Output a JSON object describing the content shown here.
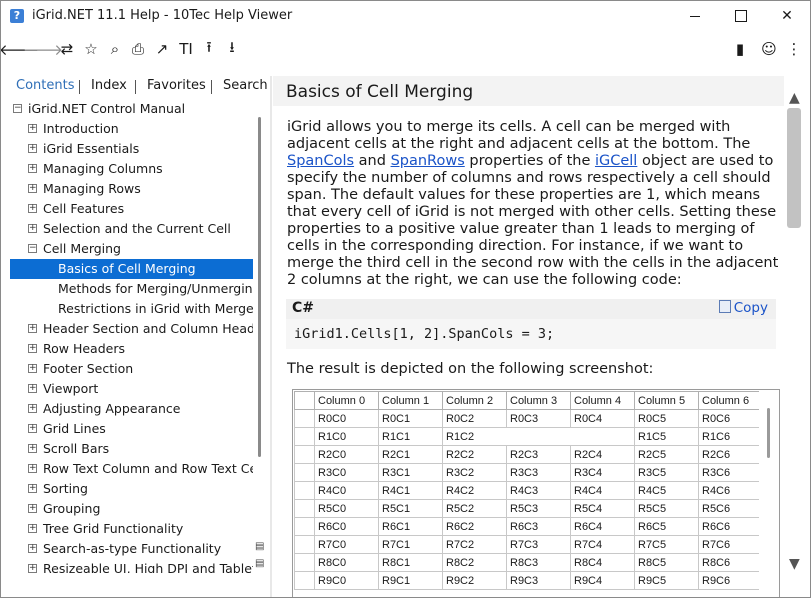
{
  "window": {
    "title": "iGrid.NET 11.1 Help - 10Tec Help Viewer",
    "app_icon": "?",
    "minimize_icon": "minimize-icon",
    "maximize_icon": "maximize-icon",
    "close_glyph": "✕"
  },
  "toolbar": {
    "back": "🡐",
    "forward": "🡒",
    "sync": "⇄",
    "favorite_add": "☆",
    "search": "⌕",
    "print": "⎙",
    "open_external": "↗",
    "font_size": "TI",
    "up": "⭱",
    "download": "⭳",
    "book": "▮",
    "smiley": "☺",
    "more": "⋮"
  },
  "tabs": [
    {
      "label": "Contents",
      "active": true
    },
    {
      "label": "Index",
      "active": false
    },
    {
      "label": "Favorites",
      "active": false
    },
    {
      "label": "Search",
      "active": false
    }
  ],
  "tree": {
    "root": {
      "label": "iGrid.NET Control Manual",
      "state": "−"
    },
    "items": [
      {
        "label": "Introduction",
        "state": "+"
      },
      {
        "label": "iGrid Essentials",
        "state": "+"
      },
      {
        "label": "Managing Columns",
        "state": "+"
      },
      {
        "label": "Managing Rows",
        "state": "+"
      },
      {
        "label": "Cell Features",
        "state": "+"
      },
      {
        "label": "Selection and the Current Cell",
        "state": "+"
      },
      {
        "label": "Cell Merging",
        "state": "−"
      },
      {
        "label": "Basics of Cell Merging",
        "state": "",
        "child": true,
        "selected": true
      },
      {
        "label": "Methods for Merging/Unmerging C",
        "state": "",
        "child": true
      },
      {
        "label": "Restrictions in iGrid with Merged C",
        "state": "",
        "child": true
      },
      {
        "label": "Header Section and Column Headers",
        "state": "+"
      },
      {
        "label": "Row Headers",
        "state": "+"
      },
      {
        "label": "Footer Section",
        "state": "+"
      },
      {
        "label": "Viewport",
        "state": "+"
      },
      {
        "label": "Adjusting Appearance",
        "state": "+"
      },
      {
        "label": "Grid Lines",
        "state": "+"
      },
      {
        "label": "Scroll Bars",
        "state": "+"
      },
      {
        "label": "Row Text Column and Row Text Cell",
        "state": "+"
      },
      {
        "label": "Sorting",
        "state": "+"
      },
      {
        "label": "Grouping",
        "state": "+"
      },
      {
        "label": "Tree Grid Functionality",
        "state": "+"
      },
      {
        "label": "Search-as-type Functionality",
        "state": "+"
      },
      {
        "label": "Resizeable UI, High DPI and Tablets",
        "state": "+"
      }
    ]
  },
  "page": {
    "title": "Basics of Cell Merging",
    "para": {
      "t1": "iGrid allows you to merge its cells. A cell can be merged with adjacent cells at the right and adjacent cells at the bottom. The ",
      "link1": "SpanCols",
      "t2": " and ",
      "link2": "SpanRows",
      "t3": " properties of the ",
      "link3": "iGCell",
      "t4": " object are used to specify the number of columns and rows respectively a cell should span. The default values for these properties are 1, which means that every cell of iGrid is not merged with other cells. Setting these properties to a positive value greater than 1 leads to merging of cells in the corresponding direction. For instance, if we want to merge the third cell in the second row with the cells in the adjacent 2 columns at the right, we can use the following code:"
    },
    "code": {
      "lang": "C#",
      "copy_label": "Copy",
      "text": "iGrid1.Cells[1, 2].SpanCols = 3;"
    },
    "result_text": "The result is depicted on the following screenshot:"
  },
  "grid": {
    "columns": [
      "Column 0",
      "Column 1",
      "Column 2",
      "Column 3",
      "Column 4",
      "Column 5",
      "Column 6"
    ],
    "rows": [
      [
        "R0C0",
        "R0C1",
        "R0C2",
        "R0C3",
        "R0C4",
        "R0C5",
        "R0C6"
      ],
      [
        "R1C0",
        "R1C1",
        "R1C2",
        "",
        "",
        "R1C5",
        "R1C6"
      ],
      [
        "R2C0",
        "R2C1",
        "R2C2",
        "R2C3",
        "R2C4",
        "R2C5",
        "R2C6"
      ],
      [
        "R3C0",
        "R3C1",
        "R3C2",
        "R3C3",
        "R3C4",
        "R3C5",
        "R3C6"
      ],
      [
        "R4C0",
        "R4C1",
        "R4C2",
        "R4C3",
        "R4C4",
        "R4C5",
        "R4C6"
      ],
      [
        "R5C0",
        "R5C1",
        "R5C2",
        "R5C3",
        "R5C4",
        "R5C5",
        "R5C6"
      ],
      [
        "R6C0",
        "R6C1",
        "R6C2",
        "R6C3",
        "R6C4",
        "R6C5",
        "R6C6"
      ],
      [
        "R7C0",
        "R7C1",
        "R7C2",
        "R7C3",
        "R7C4",
        "R7C5",
        "R7C6"
      ],
      [
        "R8C0",
        "R8C1",
        "R8C2",
        "R8C3",
        "R8C4",
        "R8C5",
        "R8C6"
      ],
      [
        "R9C0",
        "R9C1",
        "R9C2",
        "R9C3",
        "R9C4",
        "R9C5",
        "R9C6"
      ]
    ]
  },
  "scroll": {
    "up": "▲",
    "down": "▼"
  },
  "side_icons": {
    "sync_toc": "▤",
    "hide_toc": "▤"
  }
}
